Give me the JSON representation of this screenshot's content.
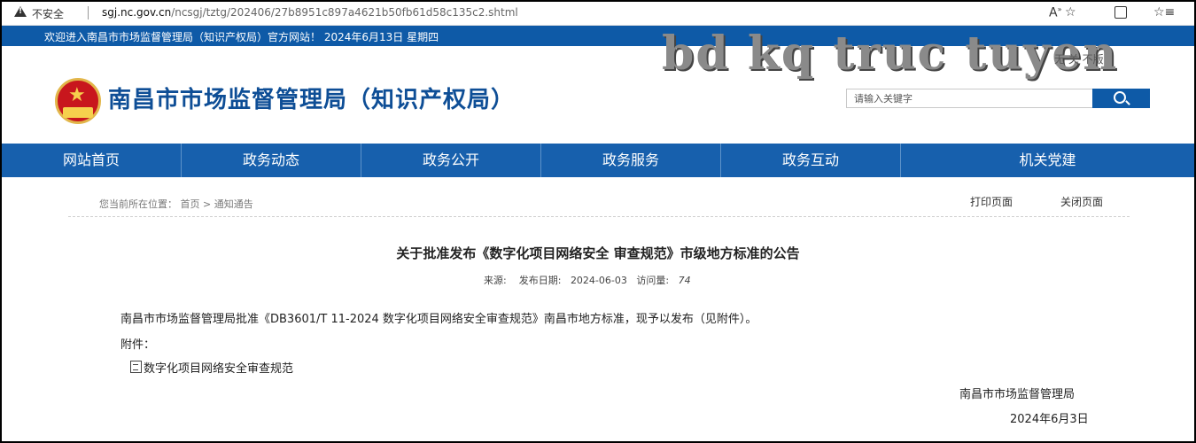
{
  "browser": {
    "security_label": "不安全",
    "url_host": "sgj.nc.gov.cn",
    "url_path": "/ncsgj/tztg/202406/27b8951c897a4621b50fb61d58c135c2.shtml",
    "icons": [
      "warning-icon",
      "read-aloud-icon",
      "favorite-star-icon",
      "split-screen-icon",
      "favorites-icon"
    ]
  },
  "top_strip": {
    "welcome_text": "欢迎进入南昌市市场监督管理局（知识产权局）官方网站！ 2024年6月13日 星期四"
  },
  "header": {
    "site_title": "南昌市市场监督管理局（知识产权局）",
    "watermark": "bd kq truc tuyen",
    "small_links": "无    关     不版",
    "search_placeholder": "请输入关键字"
  },
  "nav": {
    "items": [
      "网站首页",
      "政务动态",
      "政务公开",
      "政务服务",
      "政务互动",
      "机关党建"
    ]
  },
  "breadcrumb": {
    "prefix": "您当前所在位置：",
    "home": "首页",
    "separator": ">",
    "current": "通知通告"
  },
  "tools": {
    "print": "打印页面",
    "close": "关闭页面"
  },
  "article": {
    "title": "关于批准发布《数字化项目网络安全 审查规范》市级地方标准的公告",
    "source_label": "来源:",
    "date_label": "发布日期:",
    "date": "2024-06-03",
    "views_label": "访问量:",
    "views": "74",
    "body": "南昌市市场监督管理局批准《DB3601/T 11-2024  数字化项目网络安全审查规范》南昌市地方标准，现予以发布（见附件）。",
    "attachment_label": "附件：",
    "attachment_name": "数字化项目网络安全审查规范",
    "signature_org": "南昌市市场监督管理局",
    "signature_date": "2024年6月3日"
  },
  "colors": {
    "primary_blue": "#0e5aa7",
    "nav_blue": "#1760ad",
    "title_blue": "#0e4e96"
  }
}
